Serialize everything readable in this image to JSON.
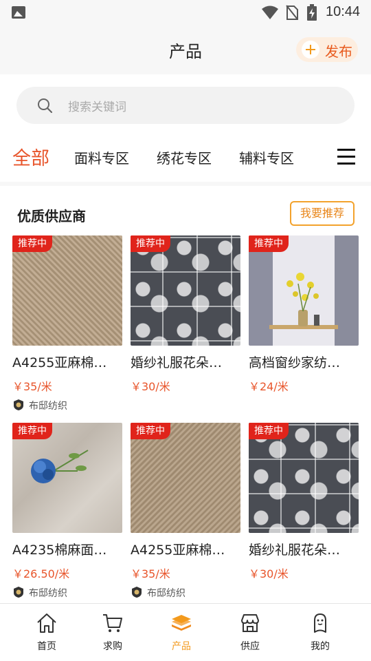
{
  "status_bar": {
    "time": "10:44"
  },
  "header": {
    "title": "产品",
    "publish_label": "发布"
  },
  "search": {
    "placeholder": "搜索关键词"
  },
  "categories": [
    "全部",
    "面料专区",
    "绣花专区",
    "辅料专区"
  ],
  "section": {
    "title": "优质供应商",
    "recommend_label": "我要推荐"
  },
  "products": [
    {
      "tag": "推荐中",
      "name": "A4255亚麻棉…",
      "price": "￥35/米",
      "supplier": "布邸纺织",
      "image": "herringbone-linen"
    },
    {
      "tag": "推荐中",
      "name": "婚纱礼服花朵…",
      "price": "￥30/米",
      "supplier": "",
      "image": "grey-lace"
    },
    {
      "tag": "推荐中",
      "name": "高档窗纱家纺…",
      "price": "￥24/米",
      "supplier": "",
      "image": "sheer-curtain"
    },
    {
      "tag": "推荐中",
      "name": "A4235棉麻面…",
      "price": "￥26.50/米",
      "supplier": "布邸纺织",
      "image": "linen-with-blue-flower"
    },
    {
      "tag": "推荐中",
      "name": "A4255亚麻棉…",
      "price": "￥35/米",
      "supplier": "布邸纺织",
      "image": "herringbone-linen"
    },
    {
      "tag": "推荐中",
      "name": "婚纱礼服花朵…",
      "price": "￥30/米",
      "supplier": "",
      "image": "grey-lace"
    }
  ],
  "bottom_nav": [
    {
      "label": "首页",
      "icon": "home-icon"
    },
    {
      "label": "求购",
      "icon": "cart-icon"
    },
    {
      "label": "产品",
      "icon": "layers-icon"
    },
    {
      "label": "供应",
      "icon": "shop-icon"
    },
    {
      "label": "我的",
      "icon": "user-icon"
    }
  ],
  "colors": {
    "accent": "#e8552b",
    "tag": "#e0241b",
    "nav_active": "#f39a1d"
  }
}
